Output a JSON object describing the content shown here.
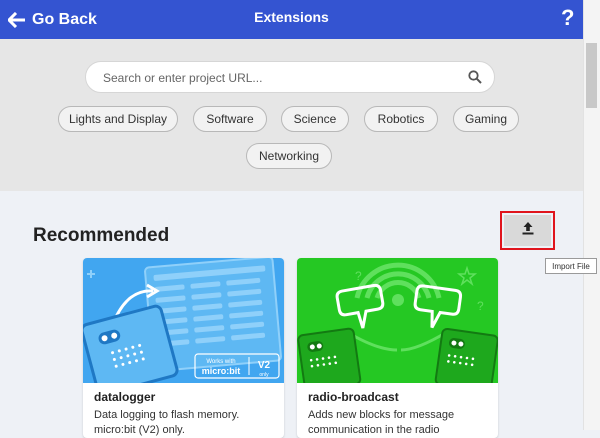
{
  "header": {
    "back_label": "Go Back",
    "title": "Extensions",
    "help_label": "?"
  },
  "search": {
    "placeholder": "Search or enter project URL..."
  },
  "categories": [
    "Lights and Display",
    "Software",
    "Science",
    "Robotics",
    "Gaming",
    "Networking"
  ],
  "recommended": {
    "title": "Recommended"
  },
  "import": {
    "tooltip": "Import File"
  },
  "cards": [
    {
      "name": "datalogger",
      "description": "Data logging to flash memory. micro:bit (V2) only.",
      "badge_line1": "Works with",
      "badge_line2": "micro:bit",
      "badge_version": "V2",
      "badge_only": "only"
    },
    {
      "name": "radio-broadcast",
      "description": "Adds new blocks for message communication in the radio"
    }
  ],
  "colors": {
    "header": "#3454d1",
    "import_highlight": "#e0141c",
    "card1_bg": "#41a6f0",
    "card2_bg": "#25c823"
  }
}
